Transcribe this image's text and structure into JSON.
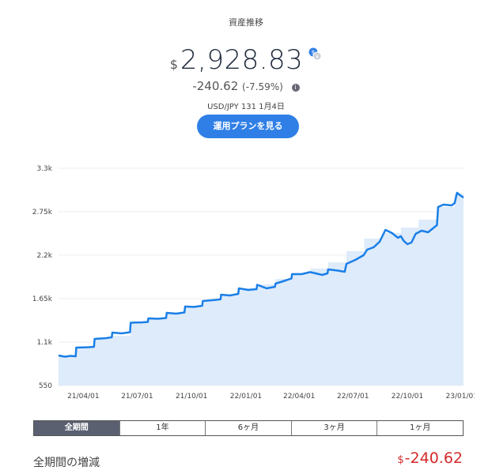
{
  "header": {
    "title": "資産推移",
    "currency_symbol": "$",
    "amount": "2,928.83",
    "change": "-240.62",
    "change_pct": "(-7.59%)",
    "fx_rate": "USD/JPY 131 1月4日",
    "plan_button": "運用プランを見る"
  },
  "tabs": [
    {
      "label": "全期間",
      "active": true
    },
    {
      "label": "1年",
      "active": false
    },
    {
      "label": "6ヶ月",
      "active": false
    },
    {
      "label": "3ヶ月",
      "active": false
    },
    {
      "label": "1ヶ月",
      "active": false
    }
  ],
  "summary": {
    "label": "全期間の増減",
    "currency_symbol": "$",
    "value": "-240.62"
  },
  "colors": {
    "line": "#1a7fe8",
    "area": "#deebfa",
    "accent": "#2f7fe6",
    "negative": "#d42a2a"
  },
  "chart_data": {
    "type": "area",
    "x_tick_labels": [
      "21/04/01",
      "21/07/01",
      "21/10/01",
      "22/01/01",
      "22/04/01",
      "22/07/01",
      "22/10/01",
      "23/01/01"
    ],
    "y_tick_labels": [
      "550",
      "1.1k",
      "1.65k",
      "2.2k",
      "2.75k",
      "3.3k"
    ],
    "ylim": [
      550,
      3300
    ],
    "grid": true,
    "series": [
      {
        "kind": "line",
        "points": [
          [
            "2021-02-18",
            930
          ],
          [
            "2021-03-01",
            915
          ],
          [
            "2021-03-10",
            925
          ],
          [
            "2021-03-19",
            920
          ],
          [
            "2021-03-20",
            1030
          ],
          [
            "2021-04-10",
            1035
          ],
          [
            "2021-04-19",
            1040
          ],
          [
            "2021-04-20",
            1140
          ],
          [
            "2021-05-10",
            1150
          ],
          [
            "2021-05-19",
            1160
          ],
          [
            "2021-05-20",
            1220
          ],
          [
            "2021-06-05",
            1210
          ],
          [
            "2021-06-19",
            1225
          ],
          [
            "2021-06-20",
            1345
          ],
          [
            "2021-07-10",
            1350
          ],
          [
            "2021-07-19",
            1355
          ],
          [
            "2021-07-20",
            1400
          ],
          [
            "2021-08-05",
            1395
          ],
          [
            "2021-08-19",
            1405
          ],
          [
            "2021-08-20",
            1470
          ],
          [
            "2021-09-05",
            1460
          ],
          [
            "2021-09-19",
            1475
          ],
          [
            "2021-09-20",
            1550
          ],
          [
            "2021-10-05",
            1545
          ],
          [
            "2021-10-19",
            1560
          ],
          [
            "2021-10-20",
            1620
          ],
          [
            "2021-11-05",
            1630
          ],
          [
            "2021-11-19",
            1640
          ],
          [
            "2021-11-20",
            1700
          ],
          [
            "2021-12-05",
            1690
          ],
          [
            "2021-12-19",
            1710
          ],
          [
            "2021-12-20",
            1780
          ],
          [
            "2022-01-05",
            1760
          ],
          [
            "2022-01-19",
            1770
          ],
          [
            "2022-01-20",
            1825
          ],
          [
            "2022-02-05",
            1780
          ],
          [
            "2022-02-19",
            1800
          ],
          [
            "2022-02-20",
            1840
          ],
          [
            "2022-03-05",
            1870
          ],
          [
            "2022-03-19",
            1905
          ],
          [
            "2022-03-20",
            1960
          ],
          [
            "2022-04-05",
            1960
          ],
          [
            "2022-04-19",
            1985
          ],
          [
            "2022-04-20",
            1985
          ],
          [
            "2022-05-10",
            1950
          ],
          [
            "2022-05-19",
            1970
          ],
          [
            "2022-05-20",
            2020
          ],
          [
            "2022-06-05",
            2005
          ],
          [
            "2022-06-17",
            1990
          ],
          [
            "2022-06-20",
            2090
          ],
          [
            "2022-07-05",
            2140
          ],
          [
            "2022-07-19",
            2200
          ],
          [
            "2022-07-25",
            2270
          ],
          [
            "2022-08-05",
            2300
          ],
          [
            "2022-08-15",
            2370
          ],
          [
            "2022-08-25",
            2520
          ],
          [
            "2022-09-05",
            2480
          ],
          [
            "2022-09-15",
            2420
          ],
          [
            "2022-09-20",
            2440
          ],
          [
            "2022-09-25",
            2380
          ],
          [
            "2022-10-01",
            2340
          ],
          [
            "2022-10-08",
            2360
          ],
          [
            "2022-10-15",
            2470
          ],
          [
            "2022-10-25",
            2510
          ],
          [
            "2022-11-05",
            2490
          ],
          [
            "2022-11-15",
            2550
          ],
          [
            "2022-11-20",
            2580
          ],
          [
            "2022-11-22",
            2810
          ],
          [
            "2022-12-01",
            2840
          ],
          [
            "2022-12-15",
            2830
          ],
          [
            "2022-12-20",
            2860
          ],
          [
            "2022-12-24",
            2990
          ],
          [
            "2022-12-28",
            2965
          ],
          [
            "2023-01-04",
            2929
          ]
        ]
      },
      {
        "kind": "area",
        "points": [
          [
            "2021-02-18",
            930
          ],
          [
            "2021-03-20",
            1030
          ],
          [
            "2021-04-20",
            1140
          ],
          [
            "2021-05-20",
            1180
          ],
          [
            "2021-06-20",
            1345
          ],
          [
            "2021-07-20",
            1400
          ],
          [
            "2021-08-20",
            1470
          ],
          [
            "2021-09-20",
            1550
          ],
          [
            "2021-10-20",
            1620
          ],
          [
            "2021-11-20",
            1700
          ],
          [
            "2021-12-20",
            1780
          ],
          [
            "2022-01-20",
            1830
          ],
          [
            "2022-02-20",
            1900
          ],
          [
            "2022-03-20",
            1975
          ],
          [
            "2022-04-20",
            2030
          ],
          [
            "2022-05-20",
            2110
          ],
          [
            "2022-06-20",
            2250
          ],
          [
            "2022-07-20",
            2410
          ],
          [
            "2022-08-20",
            2480
          ],
          [
            "2022-09-20",
            2550
          ],
          [
            "2022-10-20",
            2650
          ],
          [
            "2022-11-20",
            2810
          ],
          [
            "2022-12-20",
            2980
          ],
          [
            "2023-01-04",
            3170
          ]
        ]
      }
    ]
  }
}
